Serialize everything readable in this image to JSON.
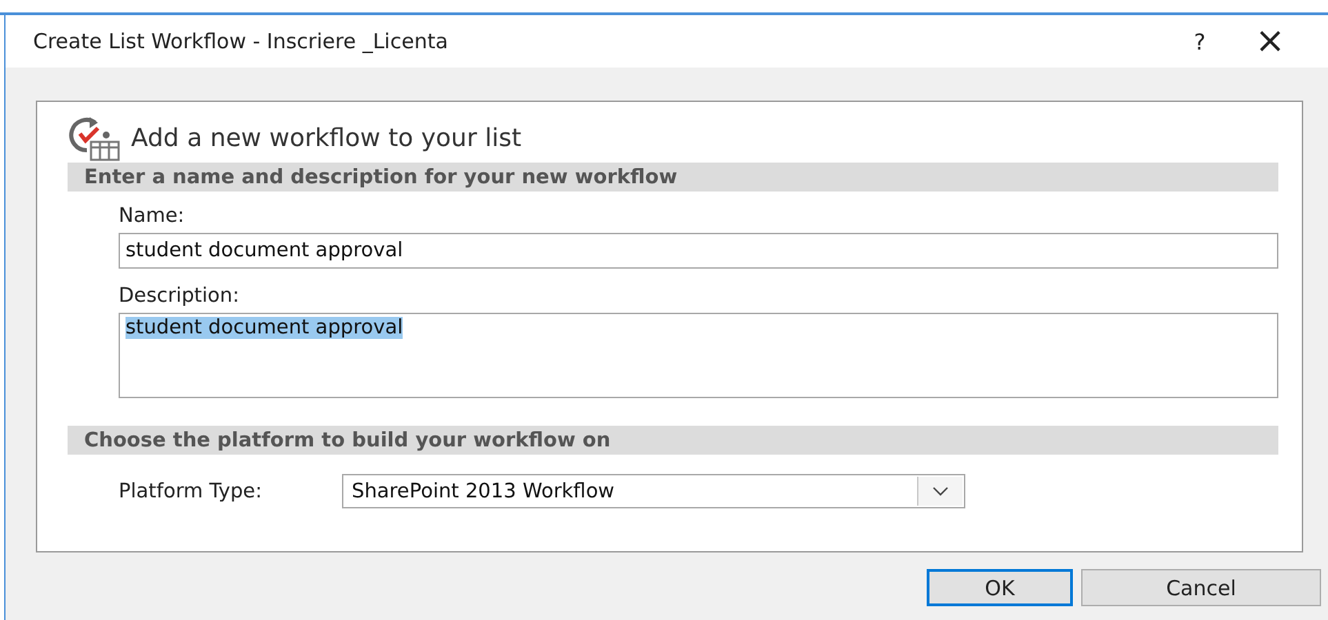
{
  "window": {
    "title": "Create List Workflow - Inscriere _Licenta",
    "help": "?",
    "close": "×"
  },
  "header": {
    "text": "Add a new workflow to your list"
  },
  "sections": [
    {
      "title": "Enter a name and description for your new workflow"
    },
    {
      "title": "Choose the platform to build your workflow on"
    }
  ],
  "name_field": {
    "label": "Name:",
    "value": "student document approval"
  },
  "description_field": {
    "label": "Description:",
    "value": "student document approval",
    "text_selected": true
  },
  "platform": {
    "label": "Platform Type:",
    "value": "SharePoint 2013 Workflow"
  },
  "buttons": [
    {
      "label": "OK",
      "default": true
    },
    {
      "label": "Cancel",
      "default": false
    }
  ]
}
